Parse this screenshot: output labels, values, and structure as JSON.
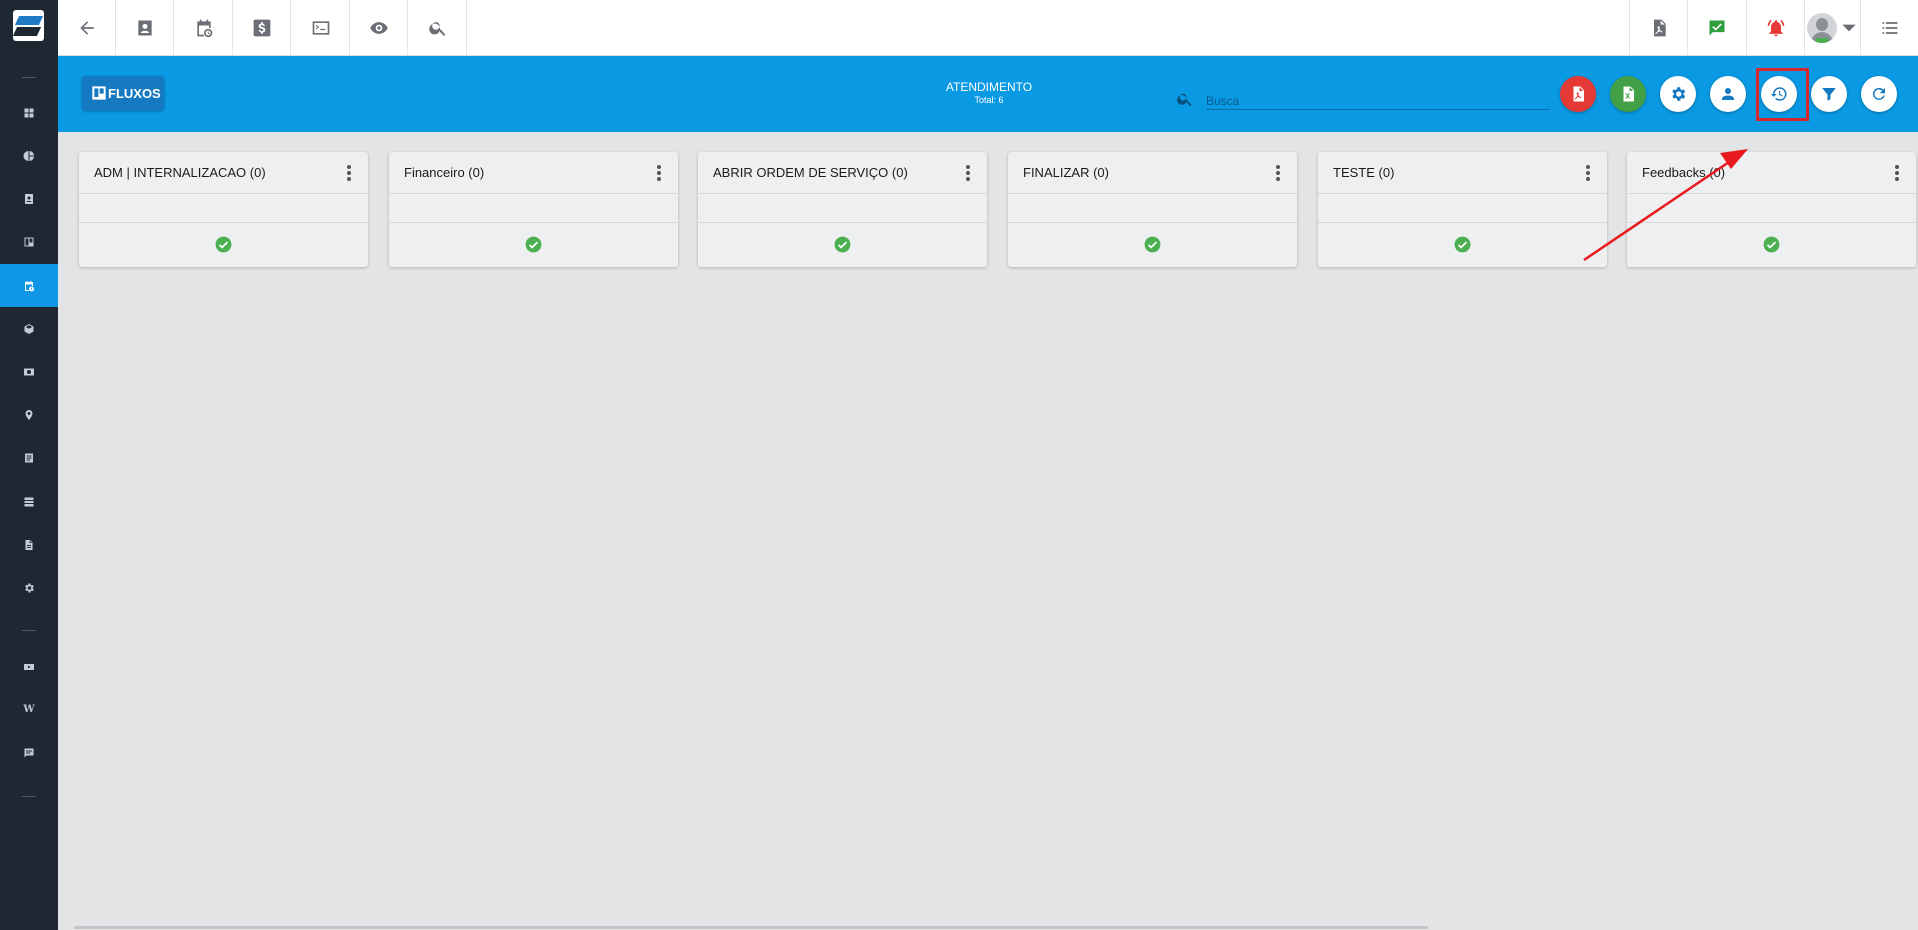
{
  "header": {
    "brand": "FLUXOS",
    "title": "ATENDIMENTO",
    "subtitle": "Total: 6",
    "search_placeholder": "Busca"
  },
  "columns": [
    {
      "name": "ADM | INTERNALIZACAO (0)"
    },
    {
      "name": "Financeiro (0)"
    },
    {
      "name": "ABRIR ORDEM DE SERVIÇO (0)"
    },
    {
      "name": "FINALIZAR (0)"
    },
    {
      "name": "TESTE (0)"
    },
    {
      "name": "Feedbacks (0)"
    }
  ],
  "colors": {
    "sidebar": "#1f2733",
    "header": "#0a9ae4",
    "active_sidebar": "#0f97e6",
    "highlight": "#d8252e",
    "pdf_button": "#e53935",
    "excel_button": "#43a047",
    "check": "#4caf50"
  },
  "icons": {
    "topbar_left": [
      "back-arrow-icon",
      "contact-card-icon",
      "calendar-clock-icon",
      "dollar-icon",
      "terminal-icon",
      "eye-icon",
      "search-icon"
    ],
    "topbar_right": [
      "pdf-file-icon",
      "chat-check-icon",
      "alarm-bell-icon",
      "user-avatar",
      "list-menu-icon"
    ],
    "header_actions": [
      "pdf-export-icon",
      "excel-export-icon",
      "settings-icon",
      "user-icon",
      "history-icon",
      "filter-icon",
      "refresh-icon"
    ]
  }
}
